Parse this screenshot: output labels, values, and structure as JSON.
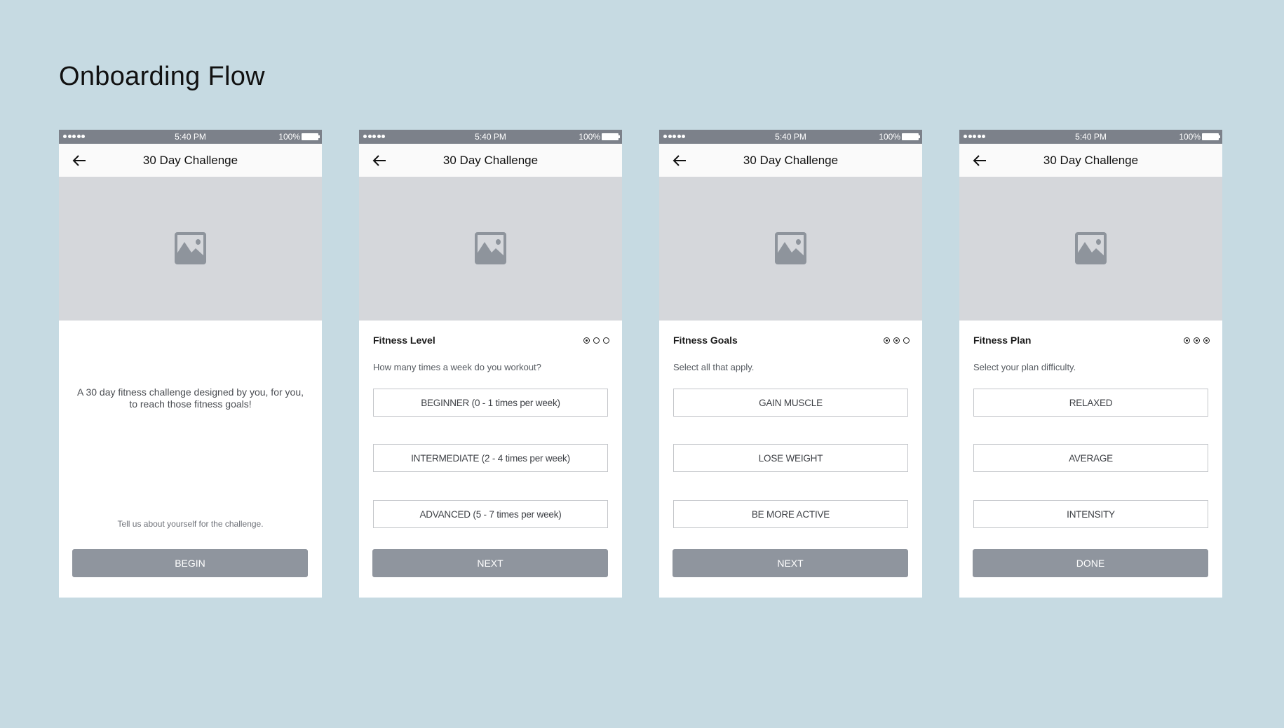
{
  "page_title": "Onboarding Flow",
  "status_bar": {
    "time": "5:40 PM",
    "battery": "100%"
  },
  "screens": [
    {
      "nav_title": "30 Day Challenge",
      "intro_text": "A 30 day fitness challenge designed by you, for you, to reach those fitness goals!",
      "footer_note": "Tell us about yourself for the challenge.",
      "button_label": "BEGIN"
    },
    {
      "nav_title": "30 Day Challenge",
      "section_title": "Fitness Level",
      "step": {
        "current": 1,
        "total": 3
      },
      "question": "How many times a week do you workout?",
      "options": [
        "BEGINNER (0 - 1 times per week)",
        "INTERMEDIATE (2 - 4 times per week)",
        "ADVANCED (5 - 7 times per week)"
      ],
      "button_label": "NEXT"
    },
    {
      "nav_title": "30 Day Challenge",
      "section_title": "Fitness Goals",
      "step": {
        "current": 2,
        "total": 3
      },
      "question": "Select all that apply.",
      "options": [
        "GAIN MUSCLE",
        "LOSE WEIGHT",
        "BE MORE ACTIVE"
      ],
      "button_label": "NEXT"
    },
    {
      "nav_title": "30 Day Challenge",
      "section_title": "Fitness Plan",
      "step": {
        "current": 3,
        "total": 3
      },
      "question": "Select your plan difficulty.",
      "options": [
        "RELAXED",
        "AVERAGE",
        "INTENSITY"
      ],
      "button_label": "DONE"
    }
  ],
  "icons": {
    "back": "arrow-left-icon",
    "hero": "image-placeholder-icon",
    "signal": "signal-dots-icon",
    "battery": "battery-icon"
  },
  "colors": {
    "background": "#c6dae2",
    "status_bar": "#7c818a",
    "header": "#fafafa",
    "placeholder": "#d5d7db",
    "placeholder_icon": "#8e949c",
    "primary_button": "#8f959e"
  }
}
